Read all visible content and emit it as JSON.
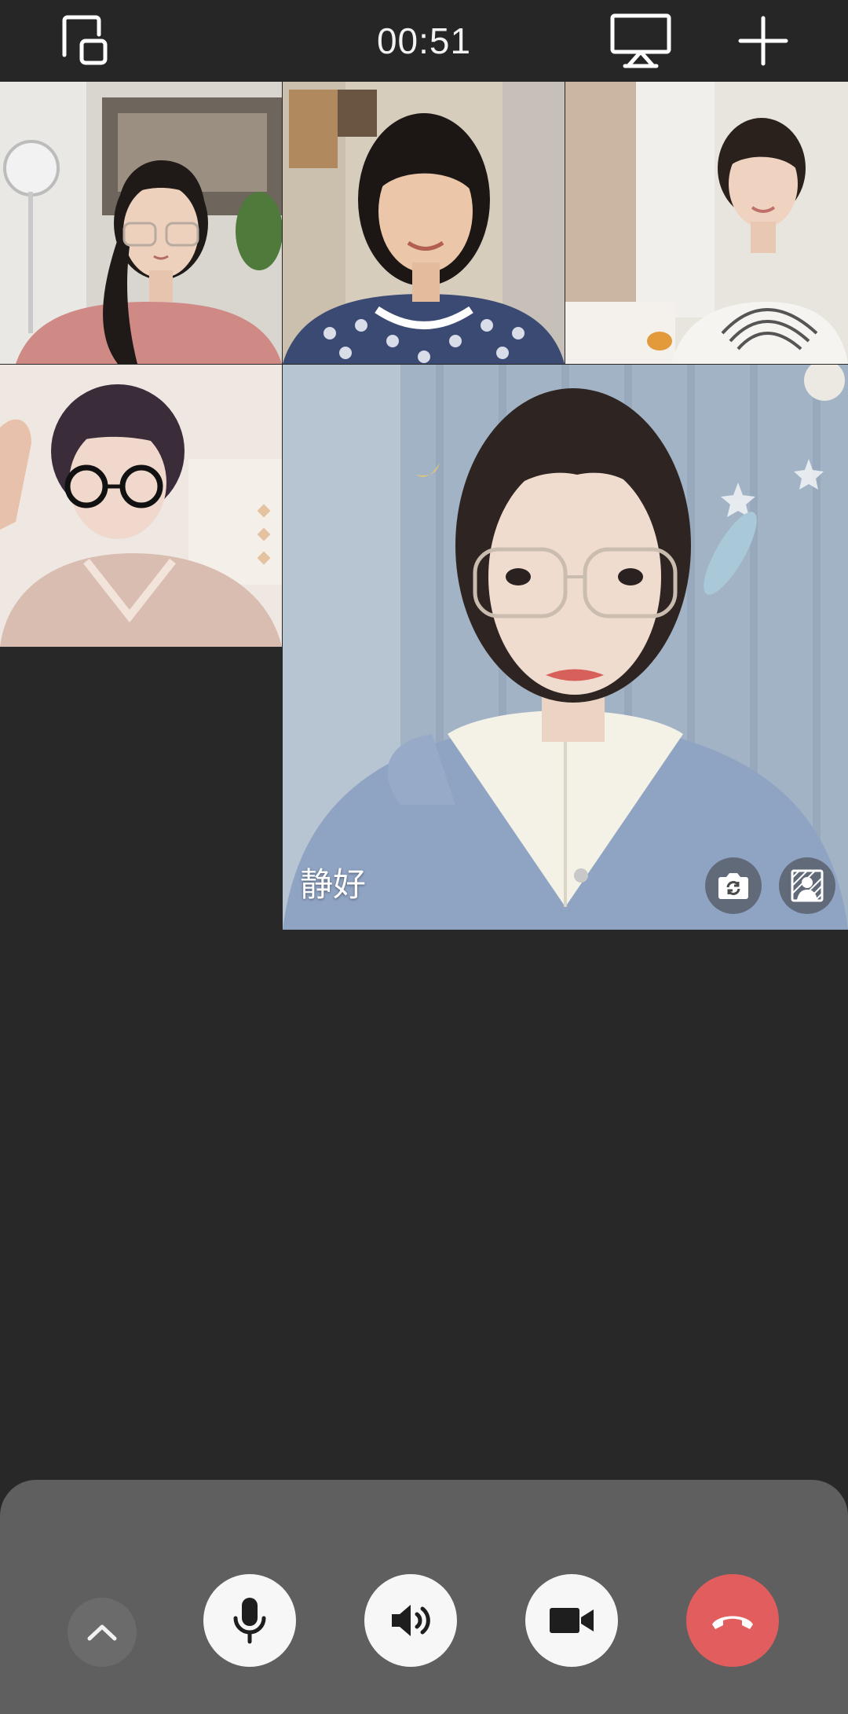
{
  "call": {
    "duration": "00:51"
  },
  "participants": [
    {
      "id": "p1",
      "name": ""
    },
    {
      "id": "p2",
      "name": ""
    },
    {
      "id": "p3",
      "name": ""
    },
    {
      "id": "p4",
      "name": ""
    },
    {
      "id": "p5",
      "name": "静好"
    }
  ],
  "colors": {
    "background": "#282828",
    "top_bar": "#262626",
    "bottom_panel": "#5f5f5f",
    "control_button": "#f7f7f7",
    "hangup_button": "#e25d5d"
  },
  "icons": {
    "top_left": "minimize-window-icon",
    "top_right_1": "screen-share-icon",
    "top_right_2": "add-icon",
    "tile_controls": [
      "switch-camera-icon",
      "background-blur-icon"
    ],
    "bottom_controls": [
      "chevron-up-icon",
      "microphone-icon",
      "speaker-icon",
      "video-camera-icon",
      "hang-up-icon"
    ]
  }
}
